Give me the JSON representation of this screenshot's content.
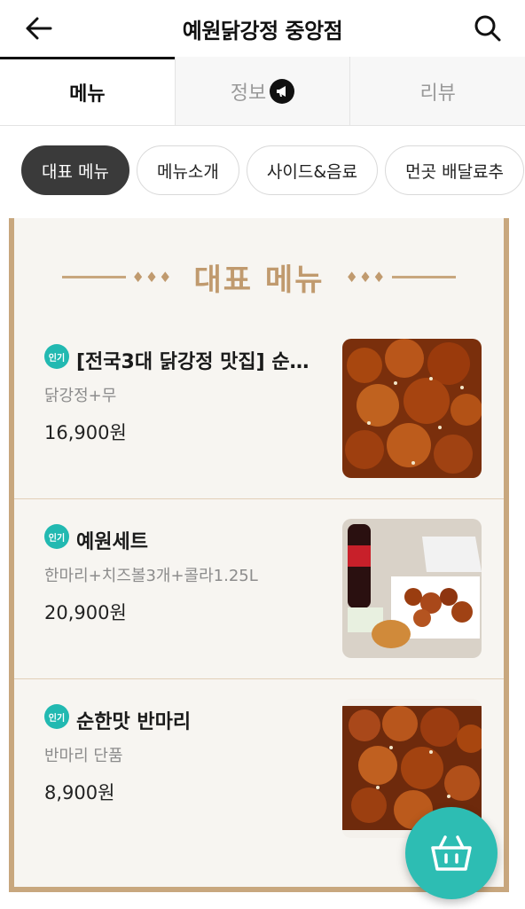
{
  "header": {
    "title": "예원닭강정 중앙점"
  },
  "tabs": [
    {
      "label": "메뉴"
    },
    {
      "label": "정보"
    },
    {
      "label": "리뷰"
    }
  ],
  "categories": [
    {
      "label": "대표 메뉴"
    },
    {
      "label": "메뉴소개"
    },
    {
      "label": "사이드&음료"
    },
    {
      "label": "먼곳 배달료추"
    }
  ],
  "section": {
    "title": "대표 메뉴"
  },
  "items": [
    {
      "badge": "인기",
      "name": "[전국3대 닭강정 맛집] 순…",
      "desc": "닭강정+무",
      "price": "16,900원"
    },
    {
      "badge": "인기",
      "name": "예원세트",
      "desc": "한마리+치즈볼3개+콜라1.25L",
      "price": "20,900원"
    },
    {
      "badge": "인기",
      "name": "순한맛 반마리",
      "desc": "반마리 단품",
      "price": "8,900원"
    }
  ],
  "colors": {
    "accent": "#2dbdb3",
    "board_trim": "#c8a77e",
    "section_title": "#c09a6e"
  },
  "icons": {
    "back": "arrow-left-icon",
    "search": "search-icon",
    "info": "megaphone-icon",
    "cart": "basket-icon"
  }
}
